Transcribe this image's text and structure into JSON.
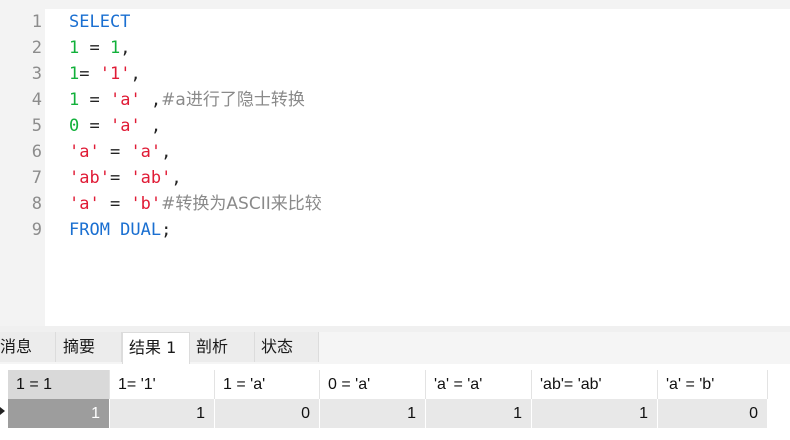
{
  "editor": {
    "line_numbers": [
      "1",
      "2",
      "3",
      "4",
      "5",
      "6",
      "7",
      "8",
      "9"
    ],
    "lines": [
      [
        {
          "t": "SELECT",
          "c": "kw"
        }
      ],
      [
        {
          "t": "1",
          "c": "num"
        },
        {
          "t": " = ",
          "c": "op"
        },
        {
          "t": "1",
          "c": "num"
        },
        {
          "t": ",",
          "c": "op"
        }
      ],
      [
        {
          "t": "1",
          "c": "num"
        },
        {
          "t": "= ",
          "c": "op"
        },
        {
          "t": "'1'",
          "c": "str"
        },
        {
          "t": ",",
          "c": "op"
        }
      ],
      [
        {
          "t": "1",
          "c": "num"
        },
        {
          "t": " = ",
          "c": "op"
        },
        {
          "t": "'a'",
          "c": "str"
        },
        {
          "t": " ,",
          "c": "op"
        },
        {
          "t": "#a进行了隐士转换",
          "c": "cm"
        }
      ],
      [
        {
          "t": "0",
          "c": "num"
        },
        {
          "t": " = ",
          "c": "op"
        },
        {
          "t": "'a'",
          "c": "str"
        },
        {
          "t": " ,",
          "c": "op"
        }
      ],
      [
        {
          "t": "'a'",
          "c": "str"
        },
        {
          "t": " = ",
          "c": "op"
        },
        {
          "t": "'a'",
          "c": "str"
        },
        {
          "t": ",",
          "c": "op"
        }
      ],
      [
        {
          "t": "'ab'",
          "c": "str"
        },
        {
          "t": "= ",
          "c": "op"
        },
        {
          "t": "'ab'",
          "c": "str"
        },
        {
          "t": ",",
          "c": "op"
        }
      ],
      [
        {
          "t": "'a'",
          "c": "str"
        },
        {
          "t": " = ",
          "c": "op"
        },
        {
          "t": "'b'",
          "c": "str"
        },
        {
          "t": "#转换为ASCII来比较",
          "c": "cm"
        }
      ],
      [
        {
          "t": "FROM DUAL",
          "c": "kw"
        },
        {
          "t": ";",
          "c": "op"
        }
      ]
    ]
  },
  "tabs": {
    "messages": "消息",
    "summary": "摘要",
    "result1": "结果 1",
    "profile": "剖析",
    "status": "状态"
  },
  "grid": {
    "headers": [
      "1 = 1",
      "1= '1'",
      "1 = 'a'",
      "0 = 'a'",
      "'a' = 'a'",
      "'ab'= 'ab'",
      "'a' = 'b'"
    ],
    "row": [
      "1",
      "1",
      "0",
      "1",
      "1",
      "1",
      "0"
    ]
  },
  "colors": {
    "keyword": "#1a6fd1",
    "number": "#11b03a",
    "string": "#e01b36",
    "comment": "#8a8a8a"
  }
}
